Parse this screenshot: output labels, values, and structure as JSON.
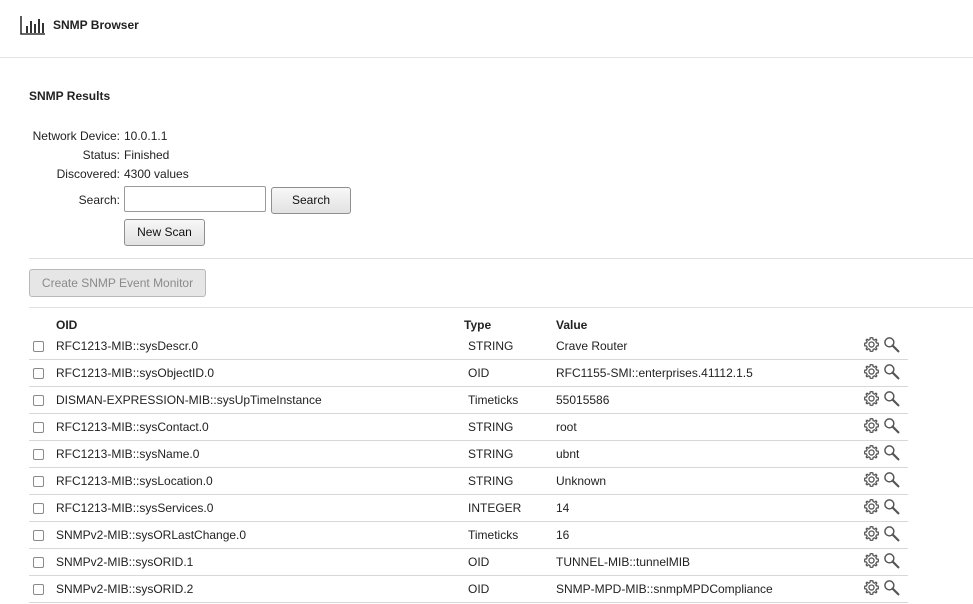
{
  "app": {
    "title": "SNMP Browser",
    "icon": "bar-chart-icon"
  },
  "results": {
    "title": "SNMP Results",
    "device_label": "Network Device:",
    "device_value": "10.0.1.1",
    "status_label": "Status:",
    "status_value": "Finished",
    "discovered_label": "Discovered:",
    "discovered_value": "4300 values",
    "search_label": "Search:",
    "search_value": "",
    "search_placeholder": "",
    "search_button": "Search",
    "new_scan_button": "New Scan"
  },
  "create_monitor_button": "Create SNMP Event Monitor",
  "table": {
    "headers": {
      "oid": "OID",
      "type": "Type",
      "value": "Value"
    },
    "rows": [
      {
        "oid": "RFC1213-MIB::sysDescr.0",
        "type": "STRING",
        "value": "Crave Router"
      },
      {
        "oid": "RFC1213-MIB::sysObjectID.0",
        "type": "OID",
        "value": "RFC1155-SMI::enterprises.41112.1.5"
      },
      {
        "oid": "DISMAN-EXPRESSION-MIB::sysUpTimeInstance",
        "type": "Timeticks",
        "value": "55015586"
      },
      {
        "oid": "RFC1213-MIB::sysContact.0",
        "type": "STRING",
        "value": "root"
      },
      {
        "oid": "RFC1213-MIB::sysName.0",
        "type": "STRING",
        "value": "ubnt"
      },
      {
        "oid": "RFC1213-MIB::sysLocation.0",
        "type": "STRING",
        "value": "Unknown"
      },
      {
        "oid": "RFC1213-MIB::sysServices.0",
        "type": "INTEGER",
        "value": "14"
      },
      {
        "oid": "SNMPv2-MIB::sysORLastChange.0",
        "type": "Timeticks",
        "value": "16"
      },
      {
        "oid": "SNMPv2-MIB::sysORID.1",
        "type": "OID",
        "value": "TUNNEL-MIB::tunnelMIB"
      },
      {
        "oid": "SNMPv2-MIB::sysORID.2",
        "type": "OID",
        "value": "SNMP-MPD-MIB::snmpMPDCompliance"
      }
    ],
    "row_actions": [
      "gear-icon",
      "magnifier-icon"
    ]
  },
  "colors": {
    "text": "#222222",
    "disabled_text": "#8a8a8a",
    "border": "#d8d8d8"
  }
}
